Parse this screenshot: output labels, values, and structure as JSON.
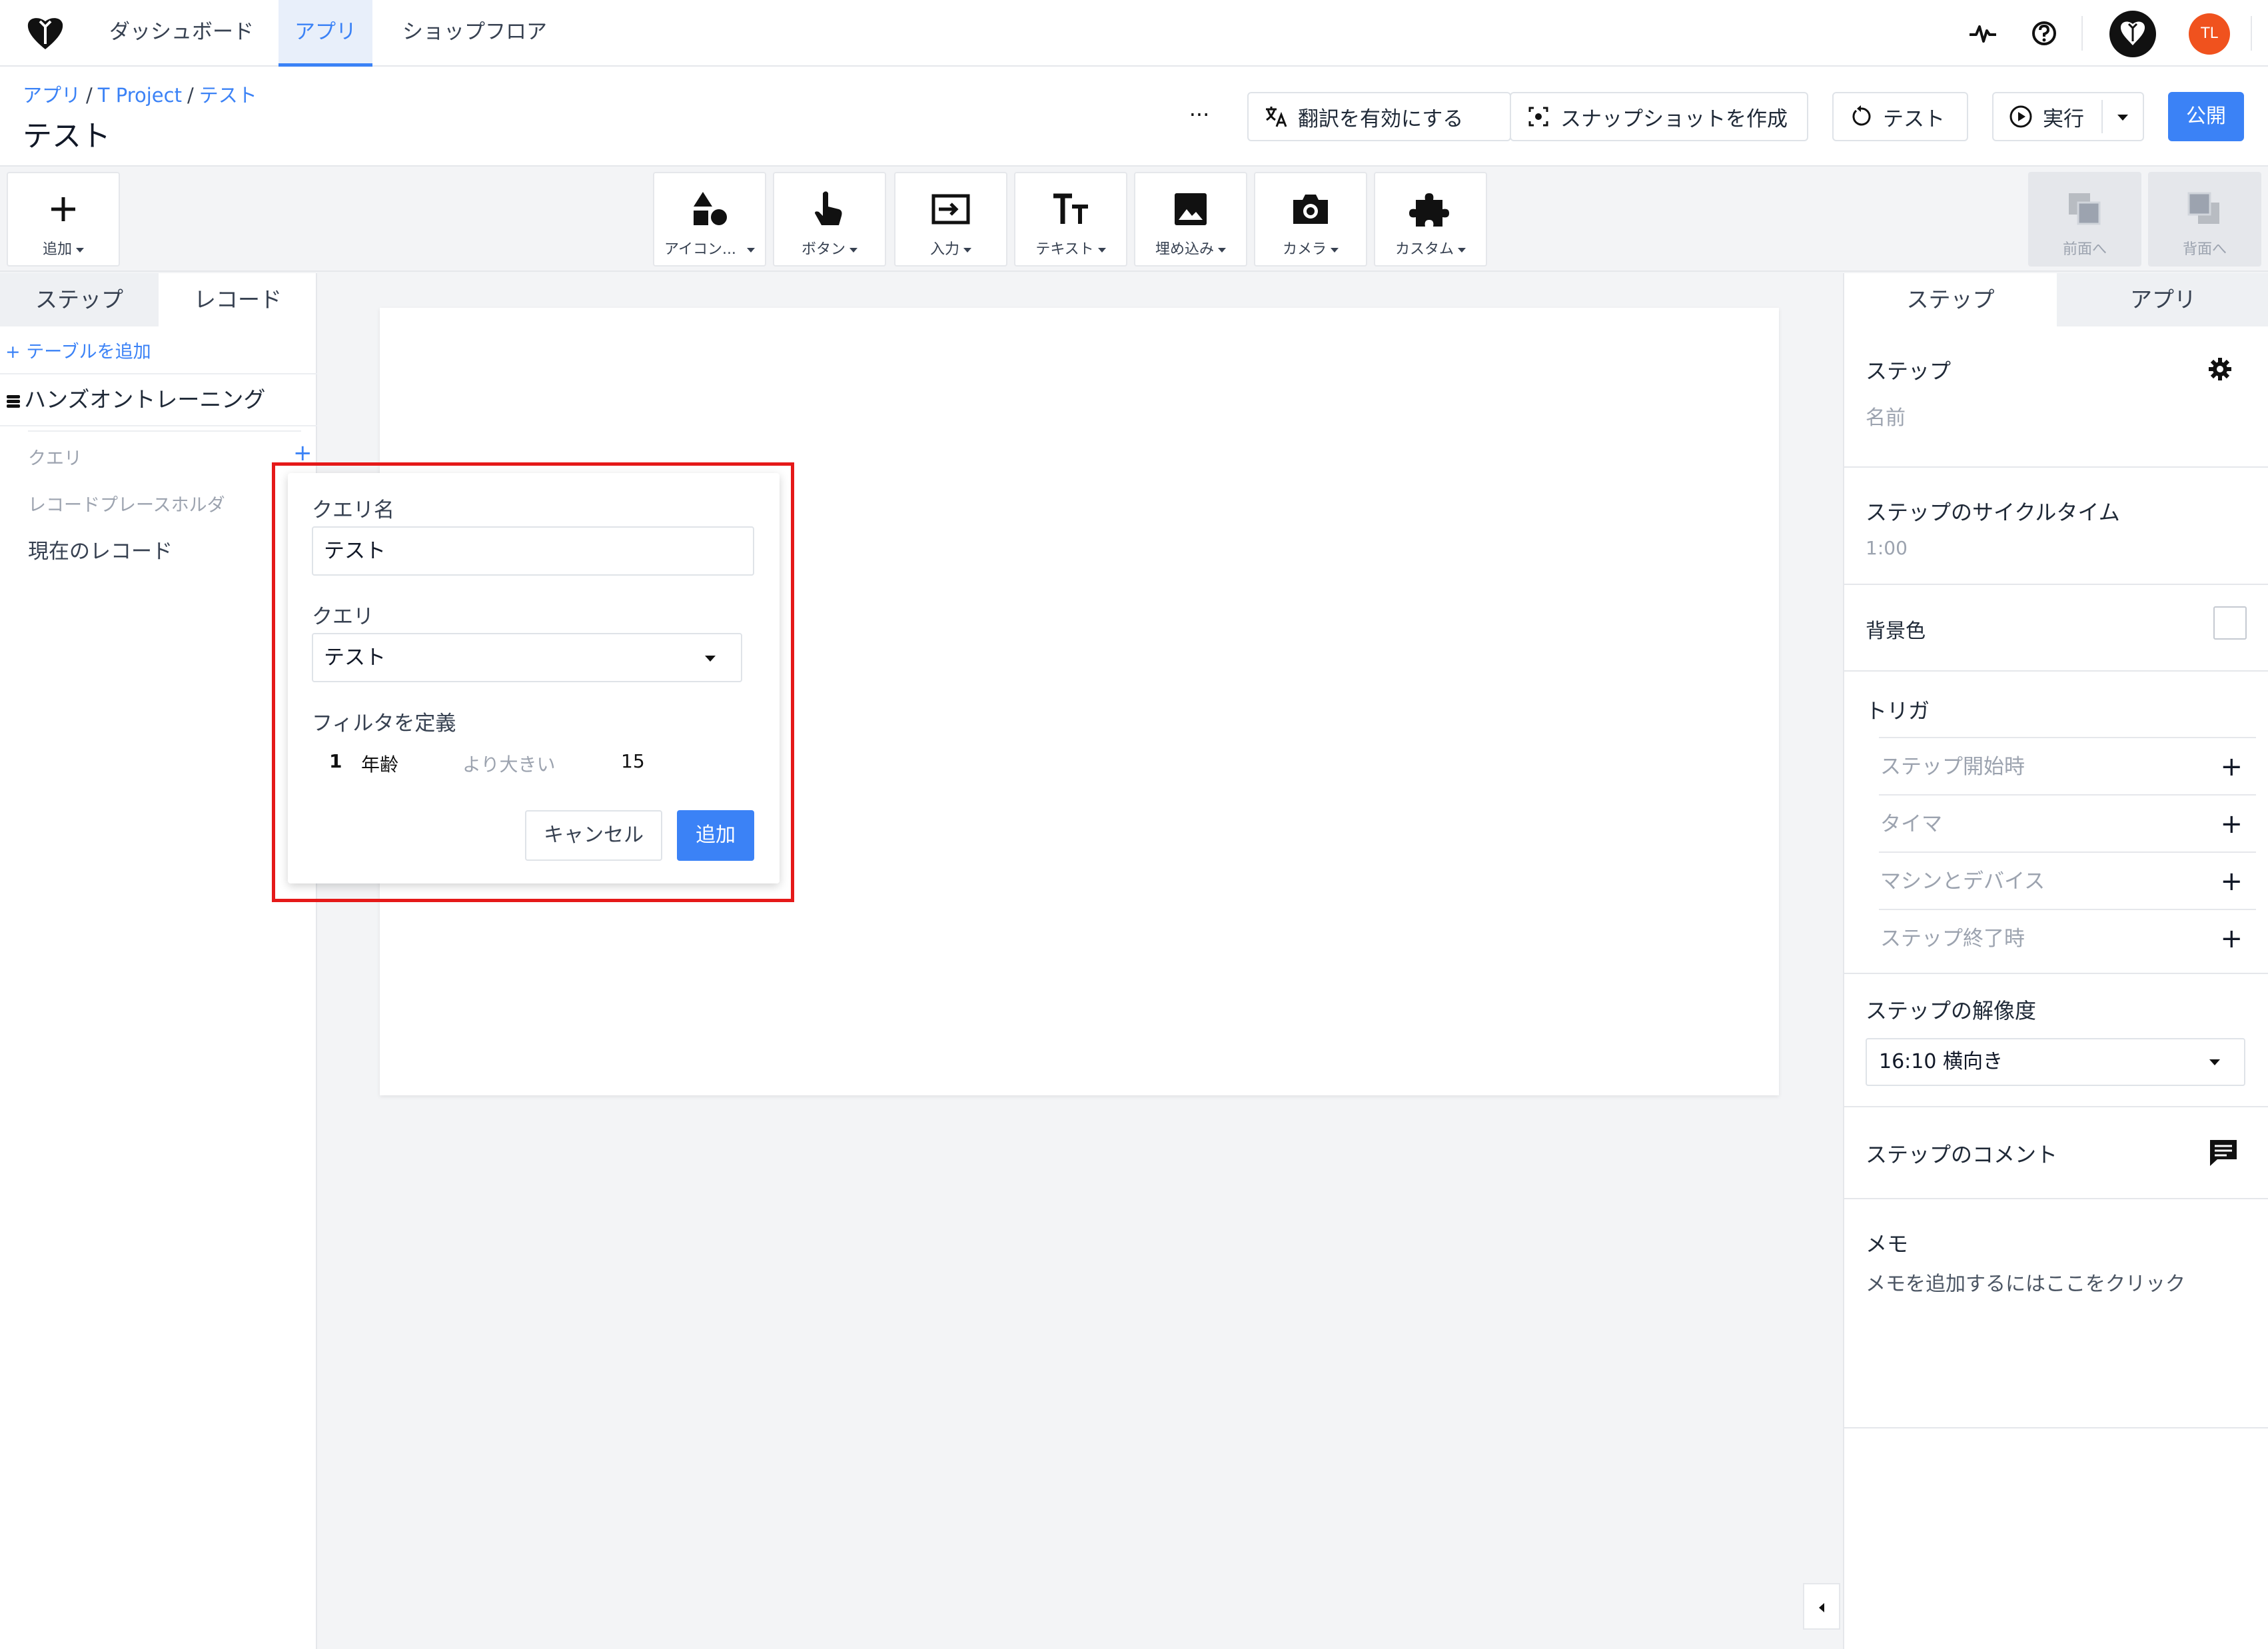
{
  "nav": {
    "tabs": [
      {
        "label": "ダッシュボード"
      },
      {
        "label": "アプリ"
      },
      {
        "label": "ショップフロア"
      }
    ],
    "avatar_initials": "TL"
  },
  "breadcrumb": {
    "items": [
      "アプリ",
      "T Project",
      "テスト"
    ],
    "separator": "/"
  },
  "page_title": "テスト",
  "header": {
    "more_label": "···",
    "translate_label": "翻訳を有効にする",
    "snapshot_label": "スナップショットを作成",
    "test_label": "テスト",
    "run_label": "実行",
    "publish_label": "公開"
  },
  "toolbar": {
    "add_label": "追加",
    "tools": [
      {
        "label": "アイコン..."
      },
      {
        "label": "ボタン"
      },
      {
        "label": "入力"
      },
      {
        "label": "テキスト"
      },
      {
        "label": "埋め込み"
      },
      {
        "label": "カメラ"
      },
      {
        "label": "カスタム"
      }
    ],
    "front_label": "前面へ",
    "back_label": "背面へ"
  },
  "left_panel": {
    "tabs": [
      "ステップ",
      "レコード"
    ],
    "add_table": "テーブルを追加",
    "table_name": "ハンズオントレーニング",
    "items": [
      "クエリ",
      "レコードプレースホルダ",
      "現在のレコード"
    ]
  },
  "popup": {
    "query_name_label": "クエリ名",
    "query_name_value": "テスト",
    "query_label": "クエリ",
    "query_value": "テスト",
    "filter_label": "フィルタを定義",
    "filter": {
      "index": "1",
      "field": "年齢",
      "op": "より大きい",
      "value": "15"
    },
    "cancel_label": "キャンセル",
    "add_label": "追加"
  },
  "right_panel": {
    "tabs": [
      "ステップ",
      "アプリ"
    ],
    "step_title": "ステップ",
    "step_name": "名前",
    "cycle_time_title": "ステップのサイクルタイム",
    "cycle_time_value": "1:00",
    "bg_color_label": "背景色",
    "triggers_title": "トリガ",
    "triggers": [
      "ステップ開始時",
      "タイマ",
      "マシンとデバイス",
      "ステップ終了時"
    ],
    "resolution_title": "ステップの解像度",
    "resolution_value": "16:10 横向き",
    "comment_title": "ステップのコメント",
    "memo_title": "メモ",
    "memo_placeholder": "メモを追加するにはここをクリック"
  },
  "colors": {
    "accent": "#3b82f6",
    "highlight": "#e51919",
    "avatar": "#f0521e"
  },
  "icons": [
    "tulip-logo",
    "pulse-icon",
    "help-icon",
    "translate-icon",
    "snapshot-icon",
    "replay-icon",
    "play-icon",
    "shapes-icon",
    "pointer-icon",
    "input-icon",
    "text-icon",
    "image-icon",
    "camera-icon",
    "puzzle-icon",
    "gear-icon",
    "comment-icon",
    "database-icon"
  ]
}
